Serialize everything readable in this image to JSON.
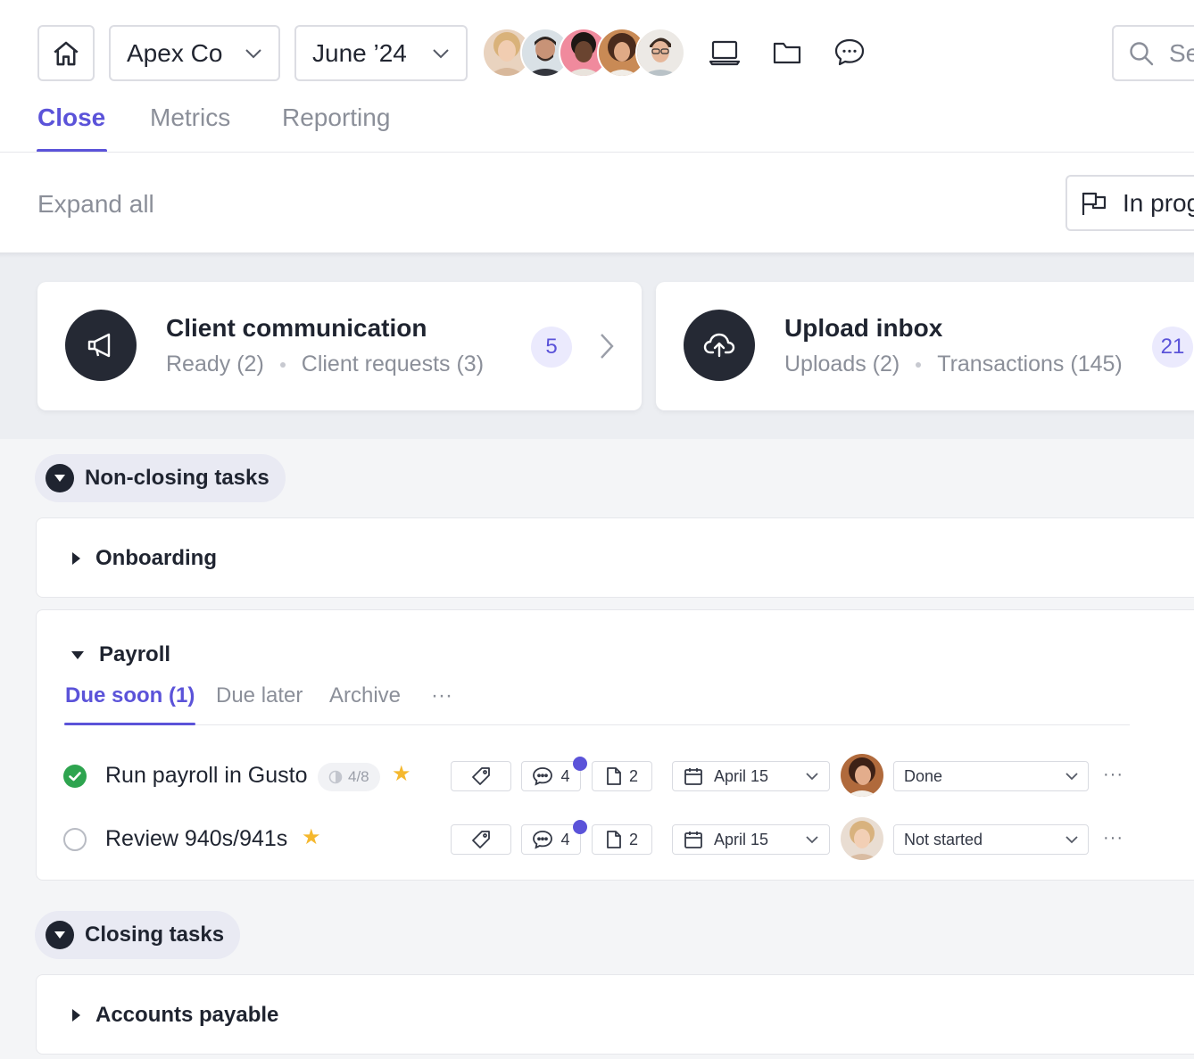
{
  "topbar": {
    "company": "Apex Co",
    "period": "June ’24",
    "search_placeholder": "Se"
  },
  "tabs": [
    {
      "label": "Close",
      "active": true
    },
    {
      "label": "Metrics",
      "active": false
    },
    {
      "label": "Reporting",
      "active": false
    }
  ],
  "toolbar": {
    "expand_all": "Expand all",
    "status_filter": "In prog"
  },
  "cards": [
    {
      "title": "Client communication",
      "meta1": "Ready (2)",
      "meta2": "Client requests (3)",
      "count": "5",
      "icon": "megaphone-icon"
    },
    {
      "title": "Upload inbox",
      "meta1": "Uploads (2)",
      "meta2": "Transactions (145)",
      "count": "21",
      "icon": "cloud-upload-icon"
    }
  ],
  "sections": {
    "non_closing": {
      "label": "Non-closing tasks",
      "groups": {
        "onboarding": {
          "label": "Onboarding",
          "expanded": false
        },
        "payroll": {
          "label": "Payroll",
          "expanded": true,
          "subtabs": [
            {
              "label": "Due soon (1)",
              "active": true
            },
            {
              "label": "Due later",
              "active": false
            },
            {
              "label": "Archive",
              "active": false
            }
          ],
          "more": "···",
          "tasks": [
            {
              "title": "Run payroll in Gusto",
              "done": true,
              "progress": "4/8",
              "starred": true,
              "comments": "4",
              "files": "2",
              "due": "April 15",
              "status": "Done",
              "more": "···"
            },
            {
              "title": "Review 940s/941s",
              "done": false,
              "progress": "",
              "starred": true,
              "comments": "4",
              "files": "2",
              "due": "April 15",
              "status": "Not started",
              "more": "···"
            }
          ]
        }
      }
    },
    "closing": {
      "label": "Closing tasks",
      "groups": {
        "accounts_payable": {
          "label": "Accounts payable",
          "expanded": false
        }
      }
    }
  },
  "colors": {
    "accent": "#5b53d9",
    "done_green": "#2ea44f",
    "star": "#f5b82e",
    "dark_icon_bg": "#252934"
  }
}
